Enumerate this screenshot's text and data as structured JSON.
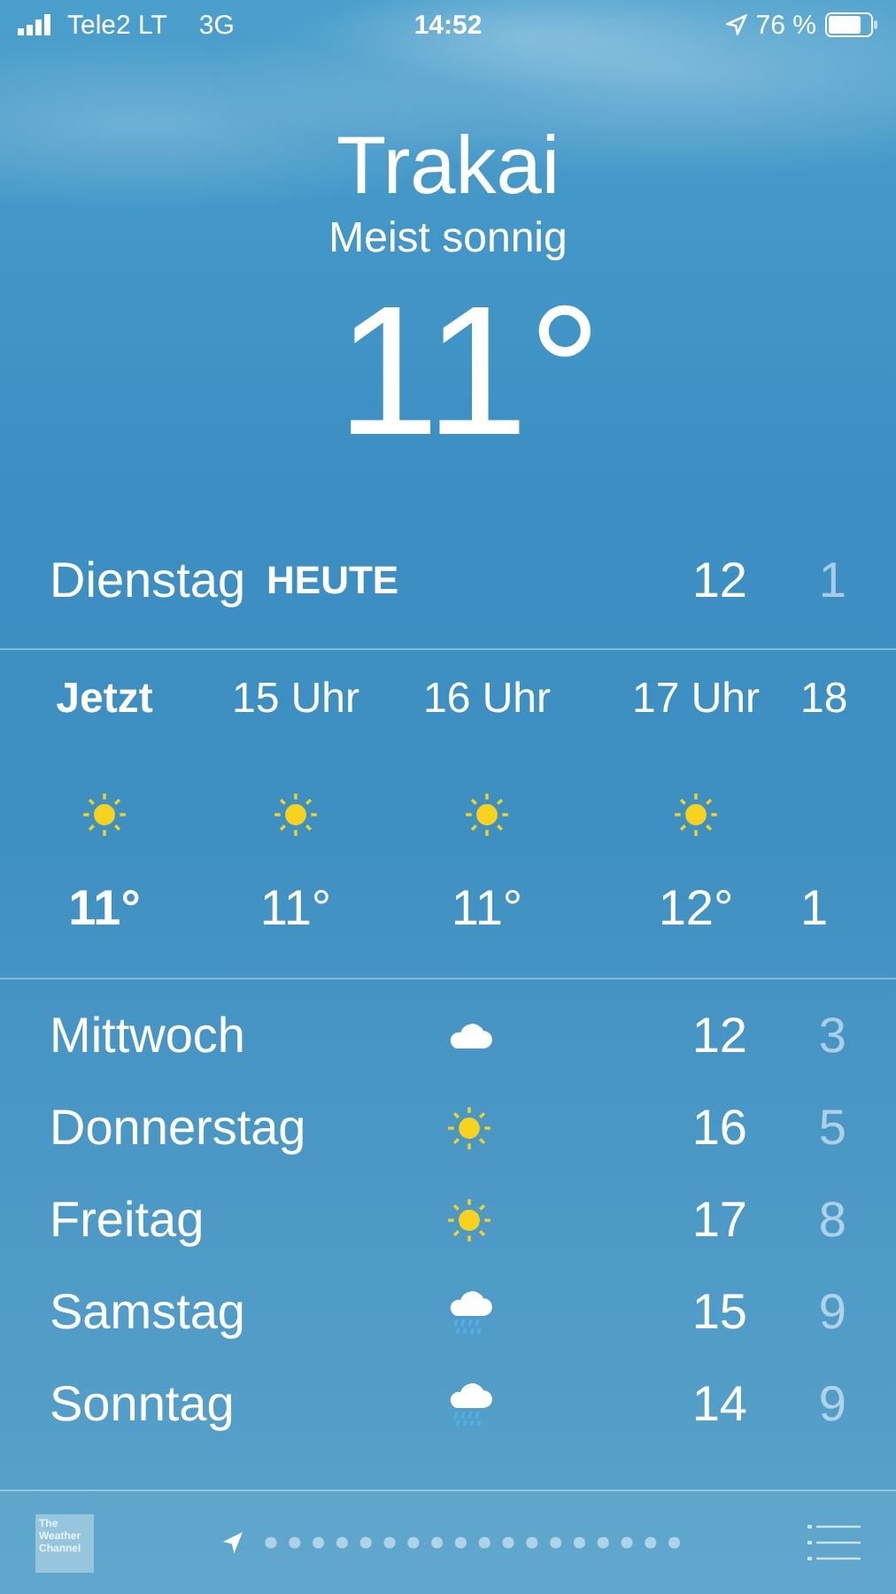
{
  "status_bar": {
    "carrier": "Tele2 LT",
    "network": "3G",
    "time": "14:52",
    "battery": "76 %"
  },
  "location": {
    "city": "Trakai",
    "condition": "Meist sonnig",
    "temperature": "11°"
  },
  "today": {
    "day": "Dienstag",
    "label": "HEUTE",
    "high": "12",
    "low": "1"
  },
  "hourly": [
    {
      "time": "Jetzt",
      "kind": "sun",
      "temperature": "11°",
      "current": true
    },
    {
      "time": "15 Uhr",
      "kind": "sun",
      "temperature": "11°",
      "current": false
    },
    {
      "time": "16 Uhr",
      "kind": "sun",
      "temperature": "11°",
      "current": false
    },
    {
      "time": "17 Uhr",
      "kind": "sun",
      "temperature": "12°",
      "current": false
    },
    {
      "time": "18",
      "temperature": "1",
      "current": false
    }
  ],
  "daily": [
    {
      "day": "Mittwoch",
      "kind": "cloud",
      "high": "12",
      "low": "3"
    },
    {
      "day": "Donnerstag",
      "kind": "sun",
      "high": "16",
      "low": "5"
    },
    {
      "day": "Freitag",
      "kind": "sun",
      "high": "17",
      "low": "8"
    },
    {
      "day": "Samstag",
      "kind": "rain",
      "high": "15",
      "low": "9"
    },
    {
      "day": "Sonntag",
      "kind": "rain",
      "high": "14",
      "low": "9"
    }
  ],
  "bottom_bar": {
    "logo": "The Weather Channel"
  }
}
